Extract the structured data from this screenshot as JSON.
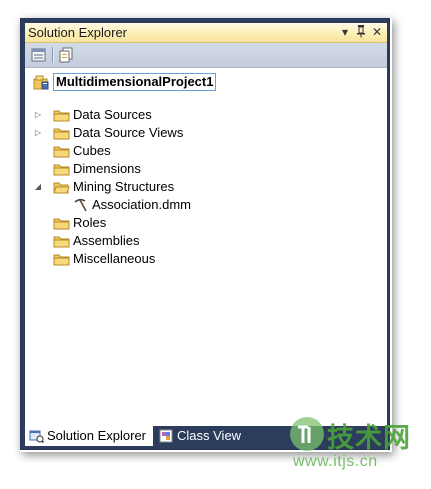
{
  "window": {
    "title": "Solution Explorer",
    "title_buttons": {
      "dropdown": "▾",
      "pin": "ᚨ",
      "close": "✕"
    }
  },
  "toolbar": {
    "buttons": [
      {
        "icon": "properties-icon"
      },
      {
        "icon": "show-all-files-icon"
      }
    ]
  },
  "tree": {
    "root": {
      "label": "MultidimensionalProject1",
      "icon": "project-icon"
    },
    "items": [
      {
        "label": "Data Sources",
        "icon": "folder-icon",
        "expander": "▷"
      },
      {
        "label": "Data Source Views",
        "icon": "folder-icon",
        "expander": "▷"
      },
      {
        "label": "Cubes",
        "icon": "folder-icon",
        "expander": ""
      },
      {
        "label": "Dimensions",
        "icon": "folder-icon",
        "expander": ""
      },
      {
        "label": "Mining Structures",
        "icon": "folder-icon",
        "expander": "◢"
      },
      {
        "label": "Association.dmm",
        "icon": "mining-pick-icon",
        "expander": ""
      },
      {
        "label": "Roles",
        "icon": "folder-icon",
        "expander": ""
      },
      {
        "label": "Assemblies",
        "icon": "folder-icon",
        "expander": ""
      },
      {
        "label": "Miscellaneous",
        "icon": "folder-icon",
        "expander": ""
      }
    ]
  },
  "tabs": [
    {
      "label": "Solution Explorer",
      "icon": "solution-explorer-icon",
      "active": true
    },
    {
      "label": "Class View",
      "icon": "class-view-icon",
      "active": false
    }
  ],
  "watermark": {
    "brand": "技术网",
    "url": "www.itjs.cn"
  },
  "colors": {
    "window_frame": "#2b3c5c",
    "title_bar": "#fcefb6",
    "toolbar": "#c9d1e0",
    "folder": "#f2c75a",
    "watermark": "#4aa339"
  }
}
